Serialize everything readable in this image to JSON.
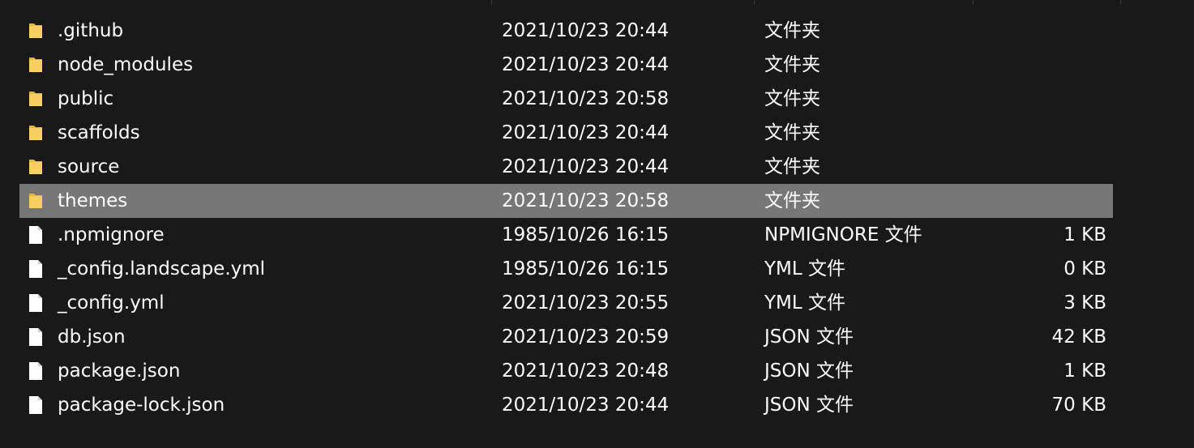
{
  "file_list": {
    "rows": [
      {
        "name": ".github",
        "date": "2021/10/23 20:44",
        "type": "文件夹",
        "size": "",
        "icon": "folder-icon",
        "selected": false
      },
      {
        "name": "node_modules",
        "date": "2021/10/23 20:44",
        "type": "文件夹",
        "size": "",
        "icon": "folder-icon",
        "selected": false
      },
      {
        "name": "public",
        "date": "2021/10/23 20:58",
        "type": "文件夹",
        "size": "",
        "icon": "folder-icon",
        "selected": false
      },
      {
        "name": "scaffolds",
        "date": "2021/10/23 20:44",
        "type": "文件夹",
        "size": "",
        "icon": "folder-icon",
        "selected": false
      },
      {
        "name": "source",
        "date": "2021/10/23 20:44",
        "type": "文件夹",
        "size": "",
        "icon": "folder-icon",
        "selected": false
      },
      {
        "name": "themes",
        "date": "2021/10/23 20:58",
        "type": "文件夹",
        "size": "",
        "icon": "folder-icon",
        "selected": true
      },
      {
        "name": ".npmignore",
        "date": "1985/10/26 16:15",
        "type": "NPMIGNORE 文件",
        "size": "1 KB",
        "icon": "file-icon",
        "selected": false
      },
      {
        "name": "_config.landscape.yml",
        "date": "1985/10/26 16:15",
        "type": "YML 文件",
        "size": "0 KB",
        "icon": "file-icon",
        "selected": false
      },
      {
        "name": "_config.yml",
        "date": "2021/10/23 20:55",
        "type": "YML 文件",
        "size": "3 KB",
        "icon": "file-icon",
        "selected": false
      },
      {
        "name": "db.json",
        "date": "2021/10/23 20:59",
        "type": "JSON 文件",
        "size": "42 KB",
        "icon": "file-icon",
        "selected": false
      },
      {
        "name": "package.json",
        "date": "2021/10/23 20:48",
        "type": "JSON 文件",
        "size": "1 KB",
        "icon": "file-icon",
        "selected": false
      },
      {
        "name": "package-lock.json",
        "date": "2021/10/23 20:44",
        "type": "JSON 文件",
        "size": "70 KB",
        "icon": "file-icon",
        "selected": false
      }
    ]
  },
  "colors": {
    "background": "#191919",
    "selected_row": "#777777",
    "folder": "#f8cf63",
    "folder_dark": "#e4b444",
    "file": "#ffffff"
  }
}
